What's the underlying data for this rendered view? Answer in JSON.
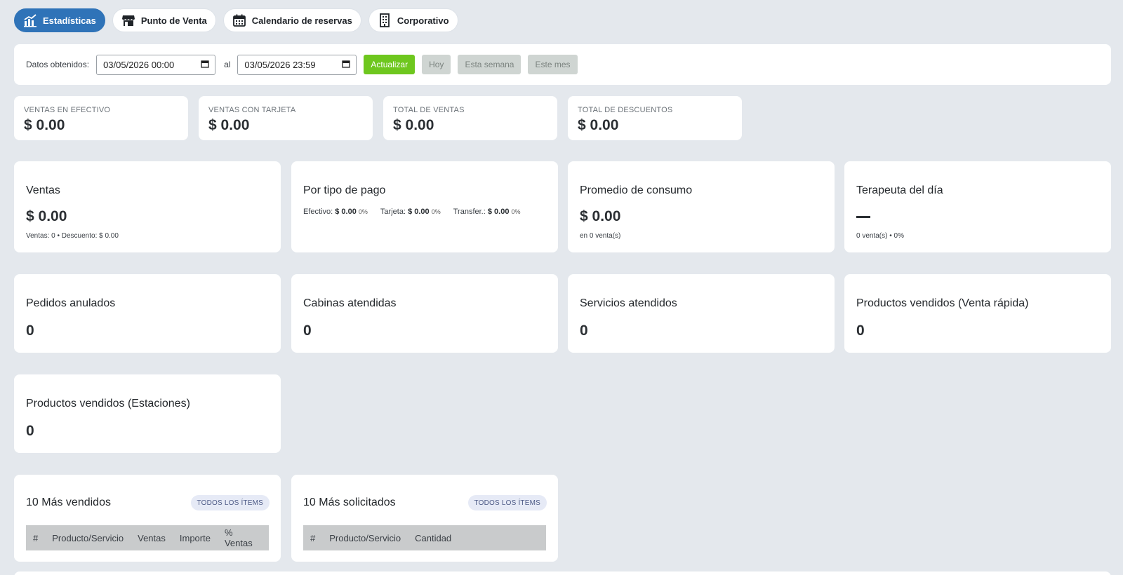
{
  "tabs": [
    {
      "label": "Estadísticas",
      "icon": "chart-icon",
      "active": true
    },
    {
      "label": "Punto de Venta",
      "icon": "store-icon",
      "active": false
    },
    {
      "label": "Calendario de reservas",
      "icon": "calendar-icon",
      "active": false
    },
    {
      "label": "Corporativo",
      "icon": "building-icon",
      "active": false
    }
  ],
  "filter": {
    "label": "Datos obtenidos:",
    "from": "03/05/2026 00:00",
    "sep": "al",
    "to": "03/05/2026 23:59",
    "update": "Actualizar",
    "today": "Hoy",
    "week": "Esta semana",
    "month": "Este mes"
  },
  "summary": [
    {
      "label": "VENTAS EN EFECTIVO",
      "value": "$ 0.00"
    },
    {
      "label": "VENTAS CON TARJETA",
      "value": "$ 0.00"
    },
    {
      "label": "TOTAL DE VENTAS",
      "value": "$ 0.00"
    },
    {
      "label": "TOTAL DE DESCUENTOS",
      "value": "$ 0.00"
    }
  ],
  "ventas": {
    "title": "Ventas",
    "value": "$ 0.00",
    "sub": "Ventas: 0 • Descuento: $ 0.00"
  },
  "pago": {
    "title": "Por tipo de pago",
    "items": [
      {
        "label": "Efectivo:",
        "value": "$ 0.00",
        "pct": "0%"
      },
      {
        "label": "Tarjeta:",
        "value": "$ 0.00",
        "pct": "0%"
      },
      {
        "label": "Transfer.:",
        "value": "$ 0.00",
        "pct": "0%"
      }
    ]
  },
  "promedio": {
    "title": "Promedio de consumo",
    "value": "$ 0.00",
    "sub": "en 0 venta(s)"
  },
  "terapeuta": {
    "title": "Terapeuta del día",
    "value": "—",
    "sub": "0 venta(s) • 0%"
  },
  "counts": [
    {
      "title": "Pedidos anulados",
      "value": "0"
    },
    {
      "title": "Cabinas atendidas",
      "value": "0"
    },
    {
      "title": "Servicios atendidos",
      "value": "0"
    },
    {
      "title": "Productos vendidos (Venta rápida)",
      "value": "0"
    },
    {
      "title": "Productos vendidos (Estaciones)",
      "value": "0"
    }
  ],
  "top_sold": {
    "title": "10 Más vendidos",
    "chip": "TODOS LOS ÍTEMS",
    "columns": [
      "#",
      "Producto/Servicio",
      "Ventas",
      "Importe",
      "% Ventas"
    ]
  },
  "top_requested": {
    "title": "10 Más solicitados",
    "chip": "TODOS LOS ÍTEMS",
    "columns": [
      "#",
      "Producto/Servicio",
      "Cantidad"
    ]
  }
}
